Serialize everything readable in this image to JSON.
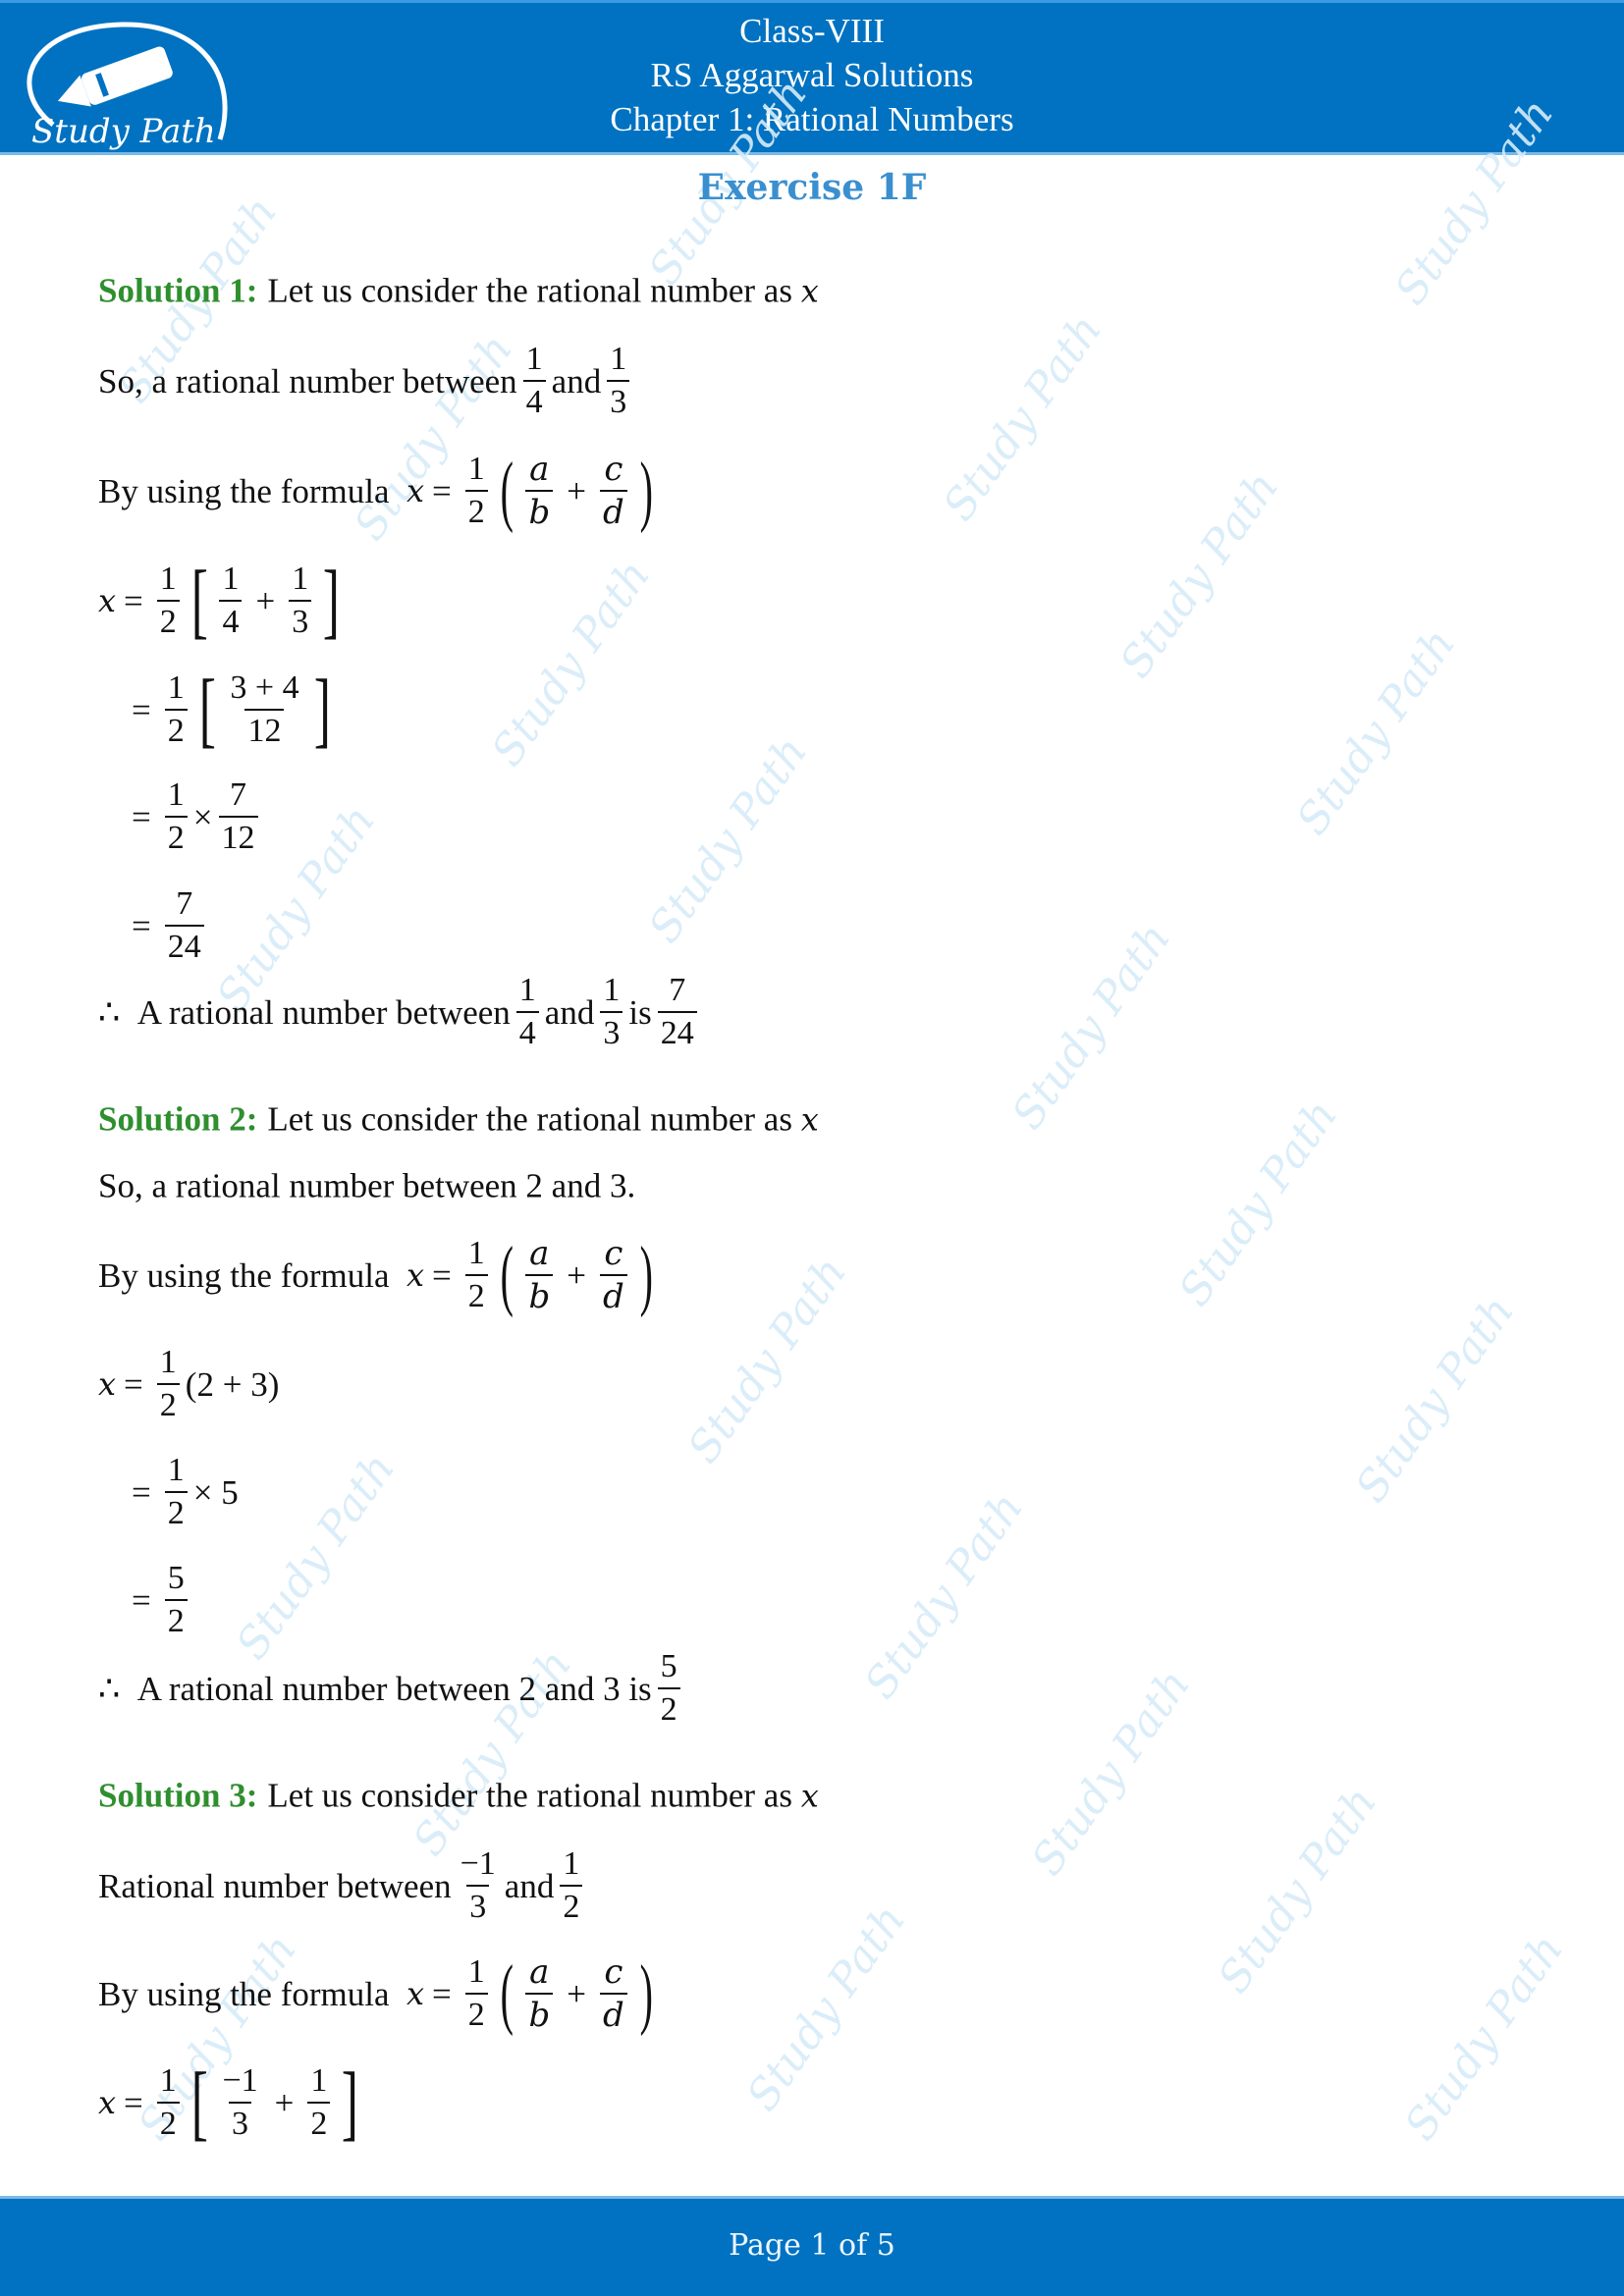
{
  "header": {
    "class": "Class-VIII",
    "book": "RS Aggarwal Solutions",
    "chapter": "Chapter 1: Rational Numbers",
    "logo_text": "Study Path",
    "logo_icon": "fountain-pen-icon",
    "background_color": "#0072c1"
  },
  "exercise_title": "Exercise 1F",
  "watermark_text": "Study Path",
  "colors": {
    "solution_label": "#2f8f2f",
    "exercise_title": "#3a8fcf",
    "watermark": "#d7ecf9"
  },
  "solutions": [
    {
      "label": "Solution 1:",
      "intro": "Let us consider the rational number as",
      "var": "x",
      "between_prefix": "So, a rational number between",
      "between_a": {
        "n": "1",
        "d": "4"
      },
      "and": "and",
      "between_b": {
        "n": "1",
        "d": "3"
      },
      "formula_prefix": "By using the formula",
      "formula": {
        "lhs": "x",
        "eq": "=",
        "half": {
          "n": "1",
          "d": "2"
        },
        "t1": {
          "n": "a",
          "d": "b"
        },
        "plus": "+",
        "t2": {
          "n": "c",
          "d": "d"
        }
      },
      "steps": [
        {
          "text": "x = 1/2 [1/4 + 1/3]",
          "a": {
            "n": "1",
            "d": "4"
          },
          "b": {
            "n": "1",
            "d": "3"
          }
        },
        {
          "text": "= 1/2 [(3 + 4)/12]",
          "f": {
            "n": "3 + 4",
            "d": "12"
          }
        },
        {
          "text": "= 1/2 × 7/12",
          "times": "×",
          "f": {
            "n": "7",
            "d": "12"
          }
        },
        {
          "text": "= 7/24",
          "f": {
            "n": "7",
            "d": "24"
          }
        }
      ],
      "conclusion": {
        "therefore": "∴",
        "text": "A rational number between",
        "a": {
          "n": "1",
          "d": "4"
        },
        "and": "and",
        "b": {
          "n": "1",
          "d": "3"
        },
        "is": "is",
        "result": {
          "n": "7",
          "d": "24"
        }
      }
    },
    {
      "label": "Solution 2:",
      "intro": "Let us consider the rational number as",
      "var": "x",
      "between_text": "So, a rational number between 2 and 3.",
      "formula_prefix": "By using the formula",
      "steps": [
        {
          "text": "x = 1/2 (2 + 3)",
          "paren": "(2 + 3)"
        },
        {
          "text": "= 1/2 × 5",
          "times": "× 5"
        },
        {
          "text": "= 5/2",
          "f": {
            "n": "5",
            "d": "2"
          }
        }
      ],
      "conclusion": {
        "therefore": "∴",
        "text": "A rational number between 2 and 3 is",
        "result": {
          "n": "5",
          "d": "2"
        }
      }
    },
    {
      "label": "Solution 3:",
      "intro": "Let us consider the rational number as",
      "var": "x",
      "between_prefix": "Rational number between",
      "between_a": {
        "n": "−1",
        "d": "3"
      },
      "and": "and",
      "between_b": {
        "n": "1",
        "d": "2"
      },
      "formula_prefix": "By using the formula",
      "steps": [
        {
          "text": "x = 1/2 [−1/3 + 1/2]",
          "a": {
            "n": "−1",
            "d": "3"
          },
          "b": {
            "n": "1",
            "d": "2"
          }
        }
      ]
    }
  ],
  "footer": {
    "page_text": "Page 1 of 5",
    "page_label": "Page",
    "current": "1",
    "of": "of",
    "total": "5"
  }
}
